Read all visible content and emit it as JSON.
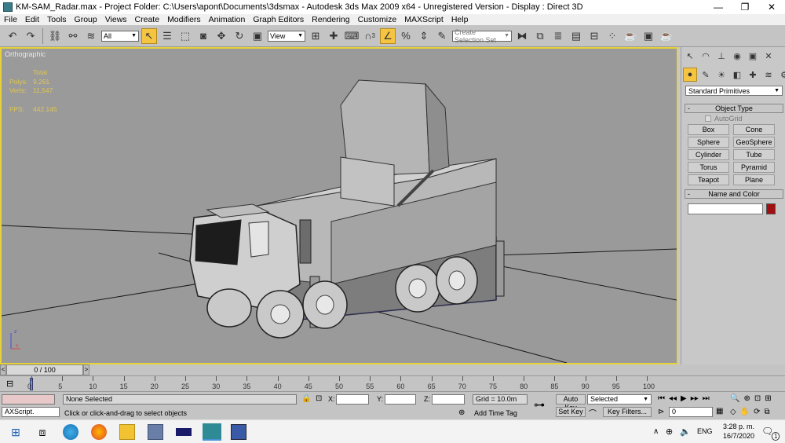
{
  "window": {
    "title": "KM-SAM_Radar.max    - Project Folder: C:\\Users\\apont\\Documents\\3dsmax    - Autodesk 3ds Max  2009 x64    - Unregistered Version    - Display : Direct 3D",
    "minimize": "—",
    "maximize": "❐",
    "close": "✕"
  },
  "menu": [
    "File",
    "Edit",
    "Tools",
    "Group",
    "Views",
    "Create",
    "Modifiers",
    "Animation",
    "Graph Editors",
    "Rendering",
    "Customize",
    "MAXScript",
    "Help"
  ],
  "toolbar": {
    "selection_filter": "All",
    "reference_coord": "View",
    "named_selection_placeholder": "Create Selection Set",
    "snap_label": "3",
    "icons": [
      "undo-icon",
      "redo-icon",
      "link-icon",
      "unlink-icon",
      "bind-space-warp-icon",
      "select-object-icon",
      "select-by-name-icon",
      "rect-selection-icon",
      "window-crossing-icon",
      "move-icon",
      "rotate-icon",
      "scale-icon",
      "pivot-icon",
      "manipulate-icon",
      "keyboard-shortcut-icon",
      "snap-icon",
      "angle-snap-icon",
      "percent-snap-icon",
      "spinner-snap-icon",
      "edit-named-sel-icon",
      "mirror-icon",
      "align-icon",
      "layer-manager-icon",
      "curve-editor-icon",
      "schematic-view-icon",
      "material-editor-icon",
      "render-setup-icon",
      "rendered-frame-icon",
      "quick-render-icon"
    ]
  },
  "viewport": {
    "label": "Orthographic",
    "stats": {
      "header": "Total",
      "polys_label": "Polys:",
      "polys_value": "9,261",
      "verts_label": "Verts:",
      "verts_value": "11,547",
      "fps_label": "FPS:",
      "fps_value": "442.145"
    },
    "axis_z": "z",
    "axis_x": "x"
  },
  "command_panel": {
    "category_dropdown": "Standard Primitives",
    "object_type_header": "Object Type",
    "autogrid_label": "AutoGrid",
    "primitives": [
      "Box",
      "Cone",
      "Sphere",
      "GeoSphere",
      "Cylinder",
      "Tube",
      "Torus",
      "Pyramid",
      "Teapot",
      "Plane"
    ],
    "name_color_header": "Name and Color",
    "object_color": "#a01010"
  },
  "timeline": {
    "frame_display": "0 / 100",
    "ticks": [
      "0",
      "5",
      "10",
      "15",
      "20",
      "25",
      "30",
      "35",
      "40",
      "45",
      "50",
      "55",
      "60",
      "65",
      "70",
      "75",
      "80",
      "85",
      "90",
      "95",
      "100"
    ]
  },
  "status": {
    "selection": "None Selected",
    "prompt": "Click or click-and-drag to select objects",
    "maxscript": "AXScript.",
    "x_label": "X:",
    "y_label": "Y:",
    "z_label": "Z:",
    "grid": "Grid = 10.0m",
    "add_time_tag": "Add Time Tag",
    "auto_key": "Auto Key",
    "set_key": "Set Key",
    "key_mode": "Selected",
    "key_filters": "Key Filters...",
    "current_frame": "0"
  },
  "taskbar": {
    "language": "ENG",
    "time": "3:28 p. m.",
    "date": "16/7/2020",
    "notification_count": "1"
  }
}
